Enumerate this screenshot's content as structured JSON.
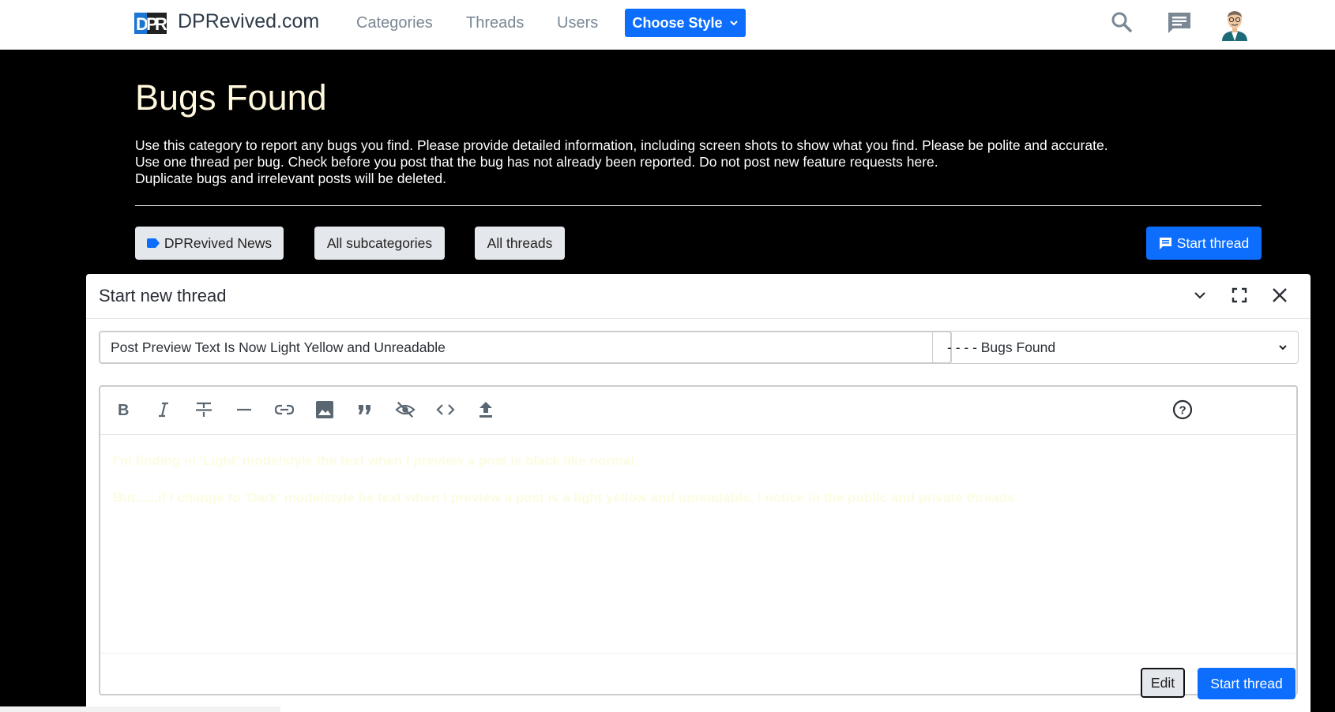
{
  "header": {
    "site_name": "DPRevived.com",
    "nav": [
      "Categories",
      "Threads",
      "Users"
    ],
    "style_button": "Choose Style",
    "accent": "#0d6efd"
  },
  "category": {
    "title": "Bugs Found",
    "description": [
      "Use this category to report any bugs you find. Please provide detailed information, including screen shots to show what you find. Please be polite and accurate.",
      "Use one thread per bug. Check before you post that the bug has not already been reported. Do not post new feature requests here.",
      "Duplicate bugs and irrelevant posts will be deleted."
    ],
    "buttons": {
      "news": "DPRevived News",
      "subcategories": "All subcategories",
      "threads": "All threads",
      "start": "Start thread"
    }
  },
  "composer": {
    "title": "Start new thread",
    "thread_title_value": "Post Preview Text Is Now Light Yellow and Unreadable",
    "category_selected": "- - - - Bugs Found",
    "preview_text": [
      "I'm finding in 'Light' mode/style the text when I preview a post is black like normal.",
      "But......if I change to 'Dark' mode/style he text when I preview a post is a light yellow and unreadable. I notice in the public and private threads."
    ],
    "edit_button": "Edit",
    "start_button": "Start thread",
    "preview_color": "#fcfce2",
    "toolbar_icons": [
      "bold-icon",
      "italic-icon",
      "strikethrough-icon",
      "horizontal-rule-icon",
      "link-icon",
      "image-icon",
      "quote-icon",
      "spoiler-icon",
      "code-icon",
      "upload-icon",
      "help-icon"
    ]
  }
}
